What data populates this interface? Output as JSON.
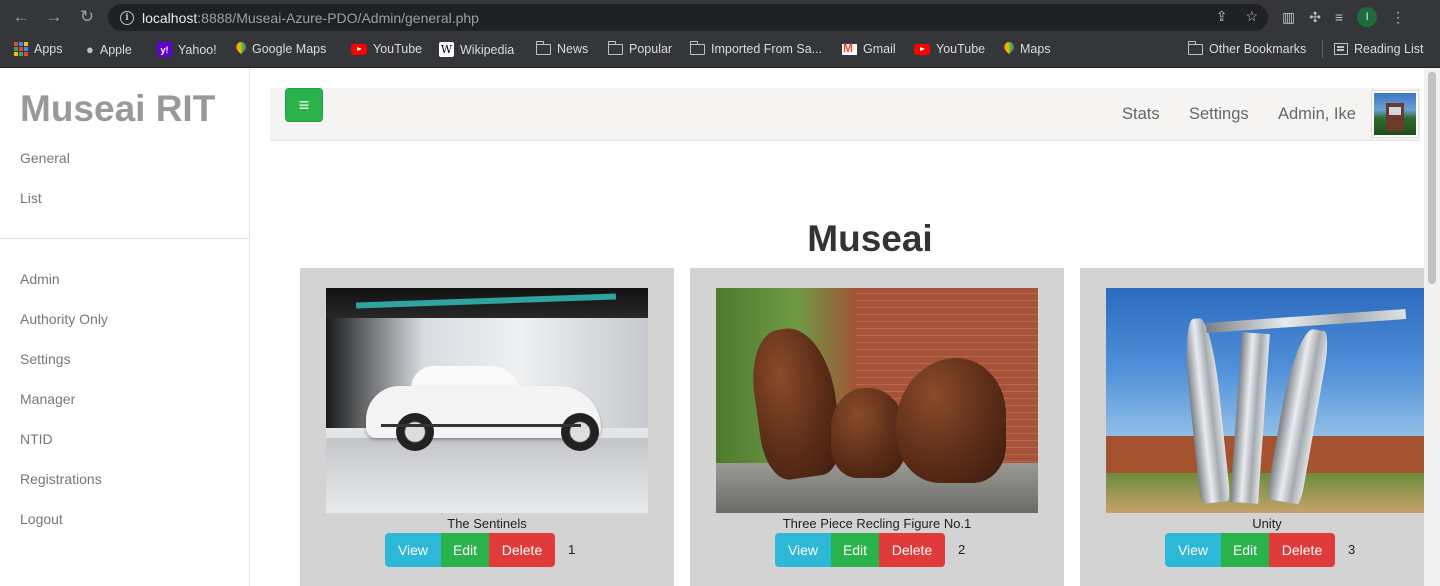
{
  "browser": {
    "url_host": "localhost",
    "url_path": ":8888/Museai-Azure-PDO/Admin/general.php",
    "profile_initial": "I"
  },
  "bookmarks": [
    {
      "label": "Apps",
      "icon": "apps-grid-icon"
    },
    {
      "label": "Apple",
      "icon": "apple-icon"
    },
    {
      "label": "Yahoo!",
      "icon": "yahoo-icon"
    },
    {
      "label": "Google Maps",
      "icon": "google-maps-icon"
    },
    {
      "label": "YouTube",
      "icon": "youtube-icon"
    },
    {
      "label": "Wikipedia",
      "icon": "wikipedia-icon"
    },
    {
      "label": "News",
      "icon": "folder-icon"
    },
    {
      "label": "Popular",
      "icon": "folder-icon"
    },
    {
      "label": "Imported From Sa...",
      "icon": "folder-icon"
    },
    {
      "label": "Gmail",
      "icon": "gmail-icon"
    },
    {
      "label": "YouTube",
      "icon": "youtube-icon"
    },
    {
      "label": "Maps",
      "icon": "maps-pin-icon"
    },
    {
      "label": "Other Bookmarks",
      "icon": "folder-icon"
    },
    {
      "label": "Reading List",
      "icon": "reading-list-icon"
    }
  ],
  "sidebar": {
    "brand": "Museai RIT",
    "top_links": [
      "General",
      "List"
    ],
    "bottom_links": [
      "Admin",
      "Authority Only",
      "Settings",
      "Manager",
      "NTID",
      "Registrations",
      "Logout"
    ]
  },
  "navbar": {
    "menu_icon": "≡",
    "links": [
      "Stats",
      "Settings",
      "Admin, Ike"
    ]
  },
  "main": {
    "heading": "Museai",
    "cards": [
      {
        "title": "The Sentinels",
        "number": "1",
        "view": "View",
        "edit": "Edit",
        "delete": "Delete"
      },
      {
        "title": "Three Piece Recling Figure No.1",
        "number": "2",
        "view": "View",
        "edit": "Edit",
        "delete": "Delete"
      },
      {
        "title": "Unity",
        "number": "3",
        "view": "View",
        "edit": "Edit",
        "delete": "Delete"
      }
    ]
  },
  "colors": {
    "view_button": "#2eb8d8",
    "edit_button": "#2bb34b",
    "delete_button": "#e03a3a",
    "card_bg": "#d3d3d3"
  }
}
